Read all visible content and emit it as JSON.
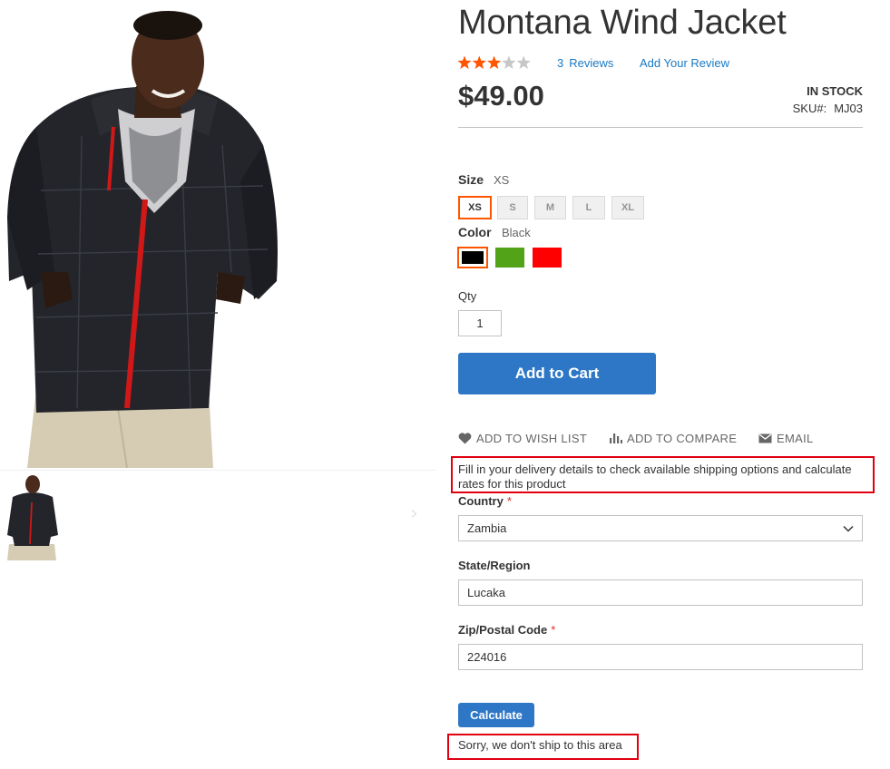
{
  "product": {
    "title": "Montana Wind Jacket",
    "rating": {
      "stars_filled": 3,
      "stars_total": 5,
      "reviews_count": "3",
      "reviews_label": "Reviews",
      "add_review": "Add Your Review"
    },
    "price": "$49.00",
    "stock": "IN STOCK",
    "sku_label": "SKU#:",
    "sku_value": "MJ03"
  },
  "size": {
    "label": "Size",
    "selected": "XS",
    "options": [
      "XS",
      "S",
      "M",
      "L",
      "XL"
    ]
  },
  "color": {
    "label": "Color",
    "selected": "Black",
    "swatches": [
      "#000000",
      "#53a318",
      "#ff0000"
    ]
  },
  "qty": {
    "label": "Qty",
    "value": "1"
  },
  "add_to_cart": "Add to Cart",
  "actions": {
    "wishlist": "ADD TO WISH LIST",
    "compare": "ADD TO COMPARE",
    "email": "EMAIL"
  },
  "shipping": {
    "message": "Fill in your delivery details to check available shipping options and calculate rates for this product",
    "country_label": "Country",
    "country_value": "Zambia",
    "state_label": "State/Region",
    "state_value": "Lucaka",
    "zip_label": "Zip/Postal Code",
    "zip_value": "224016",
    "calculate": "Calculate",
    "result": "Sorry, we don't ship to this area"
  },
  "colors": {
    "accent_link": "#1979c3",
    "primary_button": "#2e77c7",
    "selected_border": "#ff5501",
    "highlight_box": "#e0000f",
    "star": "#ff5501"
  }
}
